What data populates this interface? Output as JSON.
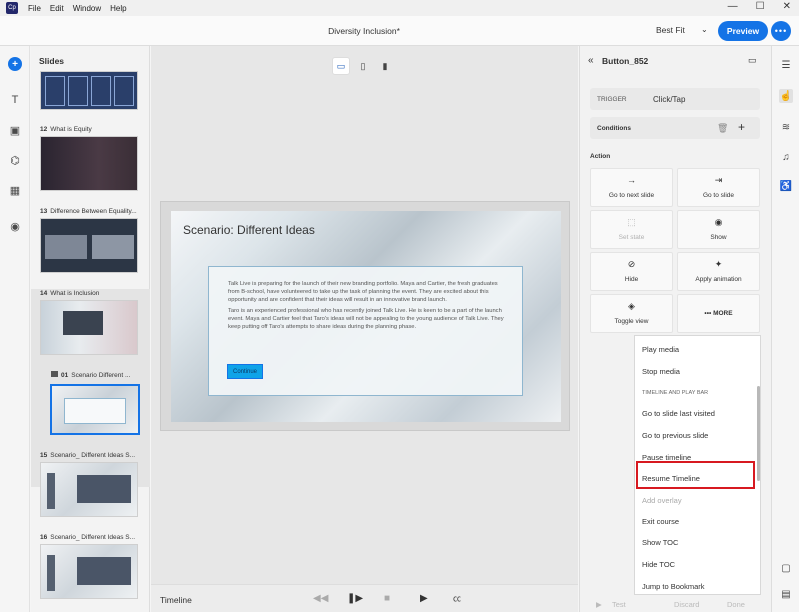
{
  "menubar": {
    "logo": "Cp",
    "items": [
      "File",
      "Edit",
      "Window",
      "Help"
    ]
  },
  "header": {
    "title": "Diversity Inclusion*",
    "fit": "Best Fit",
    "preview": "Preview",
    "more": "•••"
  },
  "slides": {
    "title": "Slides",
    "items": [
      {
        "num": "12",
        "label": "What is Equity"
      },
      {
        "num": "13",
        "label": "Difference Between Equality..."
      },
      {
        "num": "14",
        "label": "What is Inclusion"
      },
      {
        "num": "01",
        "label": "Scenario Different ..."
      },
      {
        "num": "15",
        "label": "Scenario_ Different Ideas S..."
      },
      {
        "num": "16",
        "label": "Scenario_ Different Ideas S..."
      }
    ]
  },
  "slide": {
    "title": "Scenario: Different Ideas",
    "para1": "Talk Live is preparing for the launch of their new branding portfolio. Maya and Cartier, the fresh graduates from B-school, have volunteered to take up the task of planning the event. They are excited about this opportunity and are confident that their ideas will result in an innovative brand launch.",
    "para2": "Taro is an experienced professional who has recently joined Talk Live. He is keen to be a part of the launch event. Maya and Cartier feel that Taro's ideas will not be appealing to the young audience of Talk Live. They keep putting off Taro's attempts to share ideas during the planning phase.",
    "button": "Continue"
  },
  "timeline": {
    "label": "Timeline"
  },
  "panel": {
    "object_name": "Button_852",
    "trigger_label": "TRIGGER",
    "trigger_value": "Click/Tap",
    "conditions": "Conditions",
    "action_label": "Action",
    "actions": [
      {
        "label": "Go to next slide",
        "icon": "→"
      },
      {
        "label": "Go to slide",
        "icon": "⇥"
      },
      {
        "label": "Set state",
        "icon": "⬚"
      },
      {
        "label": "Show",
        "icon": "◉"
      },
      {
        "label": "Hide",
        "icon": "⊘"
      },
      {
        "label": "Apply animation",
        "icon": "✦"
      },
      {
        "label": "Toggle view",
        "icon": "◈"
      },
      {
        "label": "MORE",
        "icon": "•••"
      }
    ],
    "dropdown": {
      "item1": "Play media",
      "item2": "Stop media",
      "heading": "TIMELINE AND PLAY BAR",
      "item3": "Go to slide last visited",
      "item4": "Go to previous slide",
      "item5": "Pause timeline",
      "item6": "Resume Timeline",
      "item7": "Add overlay",
      "item8": "Exit course",
      "item9": "Show TOC",
      "item10": "Hide TOC",
      "item11": "Jump to Bookmark"
    },
    "footer": {
      "test": "Test",
      "discard": "Discard",
      "done": "Done"
    }
  },
  "colors": {
    "accent": "#1473e6",
    "highlight": "#d71920",
    "slide_button": "#0fa3e8"
  }
}
